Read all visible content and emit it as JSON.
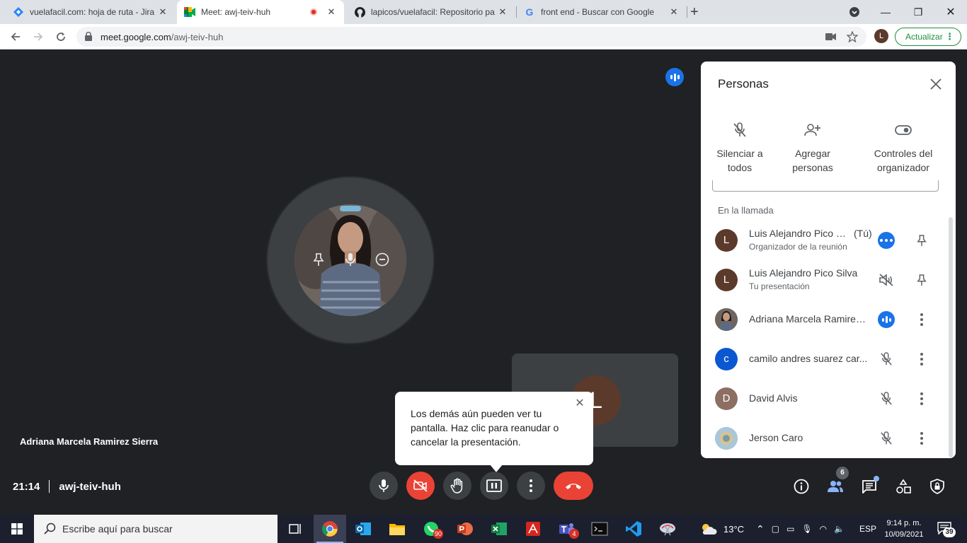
{
  "browser": {
    "tabs": [
      {
        "title": "vuelafacil.com: hoja de ruta - Jira",
        "icon": "jira-icon"
      },
      {
        "title": "Meet: awj-teiv-huh",
        "icon": "meet-icon"
      },
      {
        "title": "lapicos/vuelafacil: Repositorio pa",
        "icon": "github-icon"
      },
      {
        "title": "front end - Buscar con Google",
        "icon": "google-icon"
      }
    ],
    "url_host": "meet.google.com",
    "url_path": "/awj-teiv-huh",
    "profile_initial": "L",
    "update_label": "Actualizar"
  },
  "meet": {
    "presenter_name": "Adriana Marcela Ramirez Sierra",
    "self_initial": "L",
    "tooltip_text": "Los demás aún pueden ver tu pantalla. Haz clic para reanudar o cancelar la presentación.",
    "time": "21:14",
    "meeting_code": "awj-teiv-huh",
    "people_count": "6"
  },
  "panel": {
    "title": "Personas",
    "actions": [
      {
        "label_line1": "Silenciar a",
        "label_line2": "todos",
        "icon": "mic-off-icon"
      },
      {
        "label_line1": "Agregar",
        "label_line2": "personas",
        "icon": "add-person-icon"
      },
      {
        "label_line1": "Controles del",
        "label_line2": "organizador",
        "icon": "toggle-icon"
      }
    ],
    "section_label": "En la llamada",
    "participants": [
      {
        "name": "Luis Alejandro Pico Si...",
        "tag": "(Tú)",
        "subtitle": "Organizador de la reunión",
        "initial": "L",
        "color": "#5b3a2c"
      },
      {
        "name": "Luis Alejandro Pico Silva",
        "tag": "",
        "subtitle": "Tu presentación",
        "initial": "L",
        "color": "#5b3a2c"
      },
      {
        "name": "Adriana Marcela Ramirez ...",
        "tag": "",
        "subtitle": "",
        "initial": "",
        "color": "#6d5a55"
      },
      {
        "name": "camilo andres suarez car...",
        "tag": "",
        "subtitle": "",
        "initial": "c",
        "color": "#0b57d0"
      },
      {
        "name": "David Alvis",
        "tag": "",
        "subtitle": "",
        "initial": "D",
        "color": "#8d6e63"
      },
      {
        "name": "Jerson Caro",
        "tag": "",
        "subtitle": "",
        "initial": "",
        "color": "#8fb3c9"
      }
    ]
  },
  "taskbar": {
    "search_placeholder": "Escribe aquí para buscar",
    "whatsapp_badge": "90",
    "teams_badge": "4",
    "temperature": "13°C",
    "language": "ESP",
    "time": "9:14 p. m.",
    "date": "10/09/2021",
    "notifications": "39"
  }
}
